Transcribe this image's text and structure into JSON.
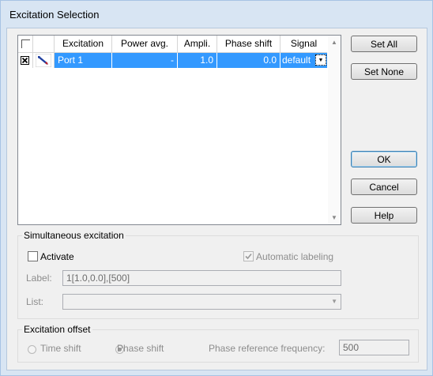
{
  "window": {
    "title": "Excitation Selection"
  },
  "table": {
    "columns": [
      "",
      "",
      "Excitation",
      "Power avg.",
      "Ampli.",
      "Phase shift",
      "Signal"
    ],
    "rows": [
      {
        "checked": true,
        "excitation": "Port 1",
        "power_avg": "-",
        "ampli": "1.0",
        "phase_shift": "0.0",
        "signal": "default"
      }
    ]
  },
  "buttons": {
    "set_all": "Set All",
    "set_none": "Set None",
    "ok": "OK",
    "cancel": "Cancel",
    "help": "Help"
  },
  "simultaneous": {
    "title": "Simultaneous excitation",
    "activate_label": "Activate",
    "activate_checked": false,
    "auto_label": "Automatic labeling",
    "auto_checked": true,
    "label_caption": "Label:",
    "label_value": "1[1.0,0.0],[500]",
    "list_caption": "List:",
    "list_value": ""
  },
  "offset": {
    "title": "Excitation offset",
    "time_shift": "Time shift",
    "phase_shift": "Phase shift",
    "selected": "phase_shift",
    "ref_freq_label": "Phase reference frequency:",
    "ref_freq_value": "500"
  }
}
